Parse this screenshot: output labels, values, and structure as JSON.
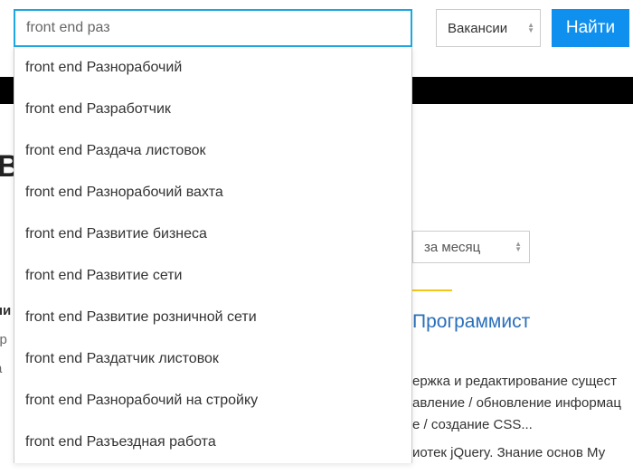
{
  "search": {
    "value": "front end раз",
    "placeholder": ""
  },
  "type_select": {
    "label": "Вакансии"
  },
  "search_button": "Найти",
  "autocomplete": [
    "front end Разнорабочий",
    "front end Разработчик",
    "front end Раздача листовок",
    "front end Разнорабочий вахта",
    "front end Развитие бизнеса",
    "front end Развитие сети",
    "front end Развитие розничной сети",
    "front end Раздатчик листовок",
    "front end Разнорабочий на стройку",
    "front end Разъездная работа"
  ],
  "big_letter": "В",
  "period_select": {
    "label": "за месяц"
  },
  "left_fragments": {
    "f1": "ни",
    "f2": "гр",
    "f3": "а"
  },
  "job_title": "Программист",
  "description": {
    "l1": "ержка и редактирование сущест",
    "l2": "авление / обновление информац",
    "l3": "е / создание CSS...",
    "l4": "иотек jQuery. Знание основ Му"
  }
}
